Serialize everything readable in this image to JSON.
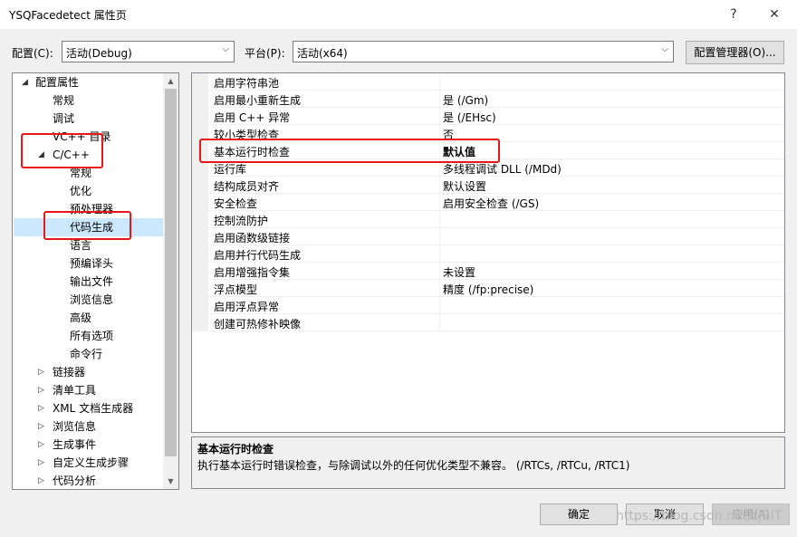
{
  "window": {
    "title": "YSQFacedetect 属性页",
    "help_glyph": "?",
    "close_glyph": "✕"
  },
  "config_row": {
    "config_label": "配置(C):",
    "config_value": "活动(Debug)",
    "platform_label": "平台(P):",
    "platform_value": "活动(x64)",
    "manager_button": "配置管理器(O)..."
  },
  "tree": {
    "nodes": [
      {
        "label": "配置属性",
        "expander": "◢"
      },
      {
        "label": "常规",
        "expander": ""
      },
      {
        "label": "调试",
        "expander": ""
      },
      {
        "label": "VC++ 目录",
        "expander": ""
      },
      {
        "label": "C/C++",
        "expander": "◢"
      },
      {
        "label": "常规",
        "expander": ""
      },
      {
        "label": "优化",
        "expander": ""
      },
      {
        "label": "预处理器",
        "expander": ""
      },
      {
        "label": "代码生成",
        "expander": ""
      },
      {
        "label": "语言",
        "expander": ""
      },
      {
        "label": "预编译头",
        "expander": ""
      },
      {
        "label": "输出文件",
        "expander": ""
      },
      {
        "label": "浏览信息",
        "expander": ""
      },
      {
        "label": "高级",
        "expander": ""
      },
      {
        "label": "所有选项",
        "expander": ""
      },
      {
        "label": "命令行",
        "expander": ""
      },
      {
        "label": "链接器",
        "expander": "▷"
      },
      {
        "label": "清单工具",
        "expander": "▷"
      },
      {
        "label": "XML 文档生成器",
        "expander": "▷"
      },
      {
        "label": "浏览信息",
        "expander": "▷"
      },
      {
        "label": "生成事件",
        "expander": "▷"
      },
      {
        "label": "自定义生成步骤",
        "expander": "▷"
      },
      {
        "label": "代码分析",
        "expander": "▷"
      }
    ]
  },
  "grid": {
    "rows": [
      {
        "name": "启用字符串池",
        "value": ""
      },
      {
        "name": "启用最小重新生成",
        "value": "是 (/Gm)"
      },
      {
        "name": "启用 C++ 异常",
        "value": "是 (/EHsc)"
      },
      {
        "name": "较小类型检查",
        "value": "否"
      },
      {
        "name": "基本运行时检查",
        "value": "默认值"
      },
      {
        "name": "运行库",
        "value": "多线程调试 DLL (/MDd)"
      },
      {
        "name": "结构成员对齐",
        "value": "默认设置"
      },
      {
        "name": "安全检查",
        "value": "启用安全检查 (/GS)"
      },
      {
        "name": "控制流防护",
        "value": ""
      },
      {
        "name": "启用函数级链接",
        "value": ""
      },
      {
        "name": "启用并行代码生成",
        "value": ""
      },
      {
        "name": "启用增强指令集",
        "value": "未设置"
      },
      {
        "name": "浮点模型",
        "value": "精度 (/fp:precise)"
      },
      {
        "name": "启用浮点异常",
        "value": ""
      },
      {
        "name": "创建可热修补映像",
        "value": ""
      }
    ]
  },
  "description": {
    "title": "基本运行时检查",
    "text": "执行基本运行时错误检查，与除调试以外的任何优化类型不兼容。      (/RTCs, /RTCu, /RTC1)"
  },
  "buttons": {
    "ok": "确定",
    "cancel": "取消",
    "apply": "应用(A)"
  },
  "watermark": "https://blog.csdn.net/zjBIT",
  "colors": {
    "highlight": "#e81818",
    "selection": "#cce8ff"
  }
}
